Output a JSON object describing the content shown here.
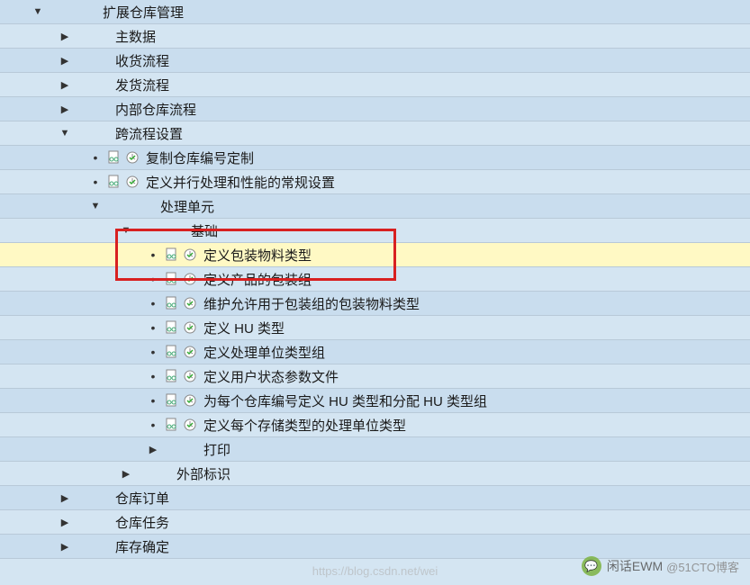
{
  "tree": {
    "root": "扩展仓库管理",
    "level1": [
      "主数据",
      "收货流程",
      "发货流程",
      "内部仓库流程",
      "跨流程设置"
    ],
    "crossProcess": {
      "items": [
        "复制仓库编号定制",
        "定义并行处理和性能的常规设置"
      ],
      "handlingUnit": "处理单元",
      "basic": "基础",
      "basicItems": [
        "定义包装物料类型",
        "定义产品的包装组",
        "维护允许用于包装组的包装物料类型",
        "定义 HU 类型",
        "定义处理单位类型组",
        "定义用户状态参数文件",
        "为每个仓库编号定义 HU 类型和分配 HU 类型组",
        "定义每个存储类型的处理单位类型"
      ],
      "print": "打印",
      "external": "外部标识"
    },
    "after": [
      "仓库订单",
      "仓库任务",
      "库存确定"
    ]
  },
  "icons": {
    "doc": "doc-glasses-icon",
    "clock": "clock-check-icon"
  },
  "watermark": {
    "right1": "闲话EWM",
    "right2": "@51CTO博客",
    "center": "https://blog.csdn.net/wei"
  }
}
